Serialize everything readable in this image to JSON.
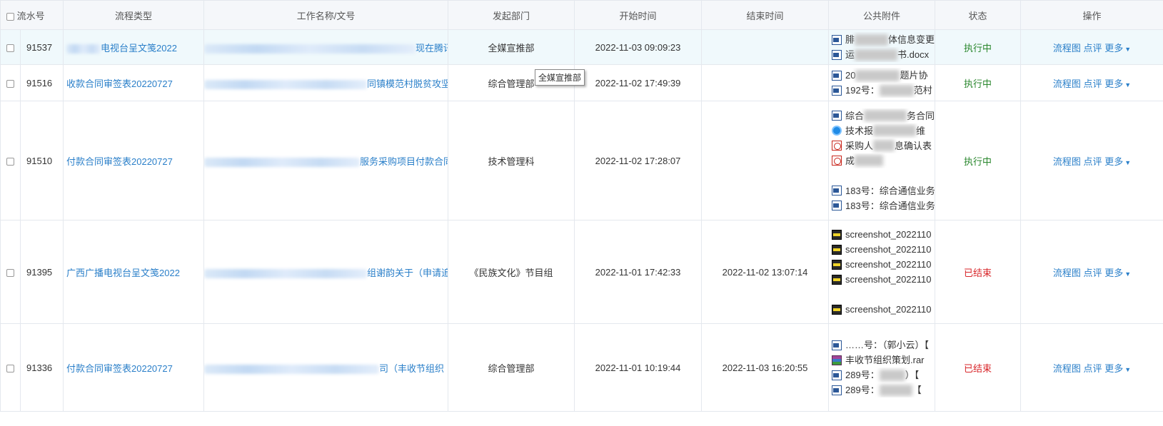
{
  "columns": {
    "no": "流水号",
    "type": "流程类型",
    "name": "工作名称/文号",
    "dept": "发起部门",
    "start": "开始时间",
    "end": "结束时间",
    "attach": "公共附件",
    "status": "状态",
    "ops": "操作"
  },
  "ops": {
    "flow": "流程图",
    "comment": "点评",
    "more": "更多"
  },
  "tooltip": "全媒宣推部",
  "rows": [
    {
      "no": "91537",
      "type_tail": "电视台呈文笺2022",
      "name_tail": "现在腾讯",
      "dept": "全媒宣推部",
      "start": "2022-11-03 09:09:23",
      "end": "",
      "status": "执行中",
      "att": [
        "体信息变更",
        "书.docx"
      ],
      "att_prefix": [
        "腓",
        "运"
      ]
    },
    {
      "no": "91516",
      "type": "收款合同审签表20220727",
      "name_tail": "同镇模范村脱贫攻坚",
      "dept": "综合管理部",
      "start": "2022-11-02 17:49:39",
      "end": "",
      "status": "执行中",
      "att": [
        "题片协",
        "范村"
      ],
      "att_prefix": [
        "20",
        "192号："
      ]
    },
    {
      "no": "91510",
      "type": "付款合同审签表20220727",
      "name_tail": "服务采购项目付款合同",
      "dept": "技术管理科",
      "start": "2022-11-02 17:28:07",
      "end": "",
      "status": "执行中",
      "att": [
        "务合同",
        "维",
        "息确认表",
        "",
        "183号：综合通信业务",
        "183号：综合通信业务"
      ],
      "att_prefix": [
        "综合",
        "技术报",
        "采购人",
        "成",
        "",
        ""
      ]
    },
    {
      "no": "91395",
      "type": "广西广播电视台呈文笺2022",
      "name_tail": "组谢韵关于（申请追",
      "dept": "《民族文化》节目组",
      "start": "2022-11-01 17:42:33",
      "end": "2022-11-02 13:07:14",
      "status": "已结束",
      "att": [
        "screenshot_2022110",
        "screenshot_2022110",
        "screenshot_2022110",
        "screenshot_2022110",
        "screenshot_2022110"
      ]
    },
    {
      "no": "91336",
      "type": "付款合同审签表20220727",
      "name_tail": "司（丰收节组织",
      "dept": "综合管理部",
      "start": "2022-11-01 10:19:44",
      "end": "2022-11-03 16:20:55",
      "status": "已结束",
      "att": [
        "……号：（郭小云）【",
        "丰收节组织策划.rar",
        "289号：",
        "289号："
      ],
      "att_suffix": [
        "",
        "",
        "）【",
        "【"
      ]
    }
  ]
}
